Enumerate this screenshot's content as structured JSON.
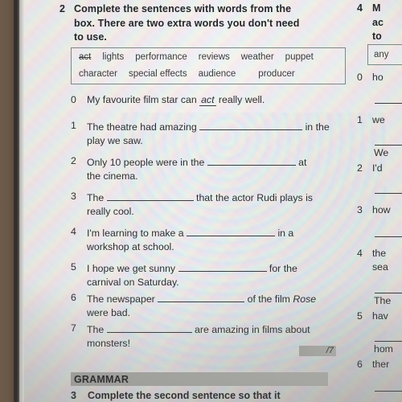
{
  "page": {
    "media": "photo-of-textbook-page",
    "paper_color": "#e8e8e4",
    "book_edge_color": "#6a5848",
    "ink_color": "#2d2f31"
  },
  "left_column": {
    "exercise": {
      "number": "2",
      "instruction_lines": [
        "Complete the sentences with words from the",
        "box. There are two extra words you don't need",
        "to use."
      ]
    },
    "word_box": {
      "row1": [
        {
          "word": "act",
          "struck_through": true
        },
        {
          "word": "lights",
          "struck_through": false
        },
        {
          "word": "performance",
          "struck_through": false
        },
        {
          "word": "reviews",
          "struck_through": false
        },
        {
          "word": "weather",
          "struck_through": false
        },
        {
          "word": "puppet",
          "struck_through": false
        }
      ],
      "row2": [
        {
          "word": "character",
          "struck_through": false
        },
        {
          "word": "special effects",
          "struck_through": false
        },
        {
          "word": "audience",
          "struck_through": false
        },
        {
          "word": "producer",
          "struck_through": false
        }
      ]
    },
    "questions": [
      {
        "number": "0",
        "before": "My favourite film star can",
        "answer": "act",
        "after": "really well.",
        "line2": ""
      },
      {
        "number": "1",
        "before": "The theatre had amazing",
        "answer": "",
        "after": "in the",
        "line2": "play we saw."
      },
      {
        "number": "2",
        "before": "Only 10 people were in the",
        "answer": "",
        "after": "at",
        "line2": "the cinema."
      },
      {
        "number": "3",
        "before": "The",
        "answer": "",
        "after": "that the actor Rudi plays is",
        "line2": "really cool."
      },
      {
        "number": "4",
        "before": "I'm learning to make a",
        "answer": "",
        "after": "in a",
        "line2": "workshop at school."
      },
      {
        "number": "5",
        "before": "I hope we get sunny",
        "answer": "",
        "after": "for the",
        "line2": "carnival on Saturday."
      },
      {
        "number": "6",
        "before": "The newspaper",
        "answer": "",
        "after_plain": "of the film",
        "after_italic": "Rose",
        "after": "of the film Rose",
        "line2": "were bad."
      },
      {
        "number": "7",
        "before": "The",
        "answer": "",
        "after": "are amazing in films about",
        "line2": "monsters!"
      }
    ],
    "score_box": "/7",
    "section_header": "GRAMMAR",
    "next_exercise": {
      "number": "3",
      "text": "Complete the second sentence so that it"
    }
  },
  "right_column": {
    "exercise": {
      "number": "4",
      "instruction_lines": [
        "M",
        "ac",
        "to"
      ]
    },
    "word_box_visible": "any",
    "questions": [
      {
        "number": "0",
        "text": "ho"
      },
      {
        "number": "1",
        "text": "we"
      },
      {
        "number": "2",
        "text": "I'd"
      },
      {
        "number": "3",
        "text": "how"
      },
      {
        "number": "4",
        "text": "the",
        "line2": "sea"
      },
      {
        "number": "5",
        "text": "hav"
      },
      {
        "number": "6",
        "text": "ther"
      }
    ],
    "continuations": [
      "We",
      "The",
      "hom"
    ]
  }
}
